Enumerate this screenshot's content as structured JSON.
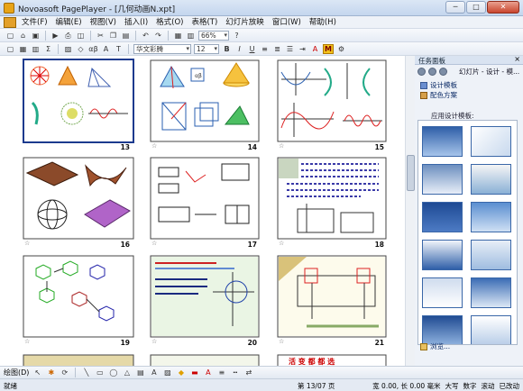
{
  "window": {
    "title": "Novoasoft PagePlayer - [几何动画N.xpt]",
    "min": "─",
    "max": "□",
    "close": "✕"
  },
  "menu": [
    "文件(F)",
    "编辑(E)",
    "视图(V)",
    "插入(I)",
    "格式(O)",
    "表格(T)",
    "幻灯片放映",
    "窗口(W)",
    "帮助(H)"
  ],
  "toolbar": {
    "zoom": "66%",
    "font": "华文彩腾",
    "font_size": "12",
    "badge": "M"
  },
  "slides": [
    {
      "num": "13",
      "selected": true
    },
    {
      "num": "14",
      "selected": false
    },
    {
      "num": "15",
      "selected": false
    },
    {
      "num": "16",
      "selected": false
    },
    {
      "num": "17",
      "selected": false
    },
    {
      "num": "18",
      "selected": false
    },
    {
      "num": "19",
      "selected": false
    },
    {
      "num": "20",
      "selected": false
    },
    {
      "num": "21",
      "selected": false
    }
  ],
  "taskpane": {
    "header": "任务面板",
    "nav_label": "幻灯片 - 设计 - 模...",
    "link_design": "设计模板",
    "link_color": "配色方案",
    "section": "应用设计模板:",
    "browse": "浏览..."
  },
  "drawbar": {
    "label": "绘图(D)"
  },
  "status": {
    "left": "就绪",
    "page": "第 13/07 页",
    "position": "宽 0.00, 长 0.00 毫米",
    "indicators": [
      "大写",
      "数字",
      "滚动",
      "已改动"
    ]
  },
  "colors": {
    "accent": "#1c3a8e",
    "titlebar": "#c4d6ee",
    "taskpane": "#eef2f8"
  }
}
